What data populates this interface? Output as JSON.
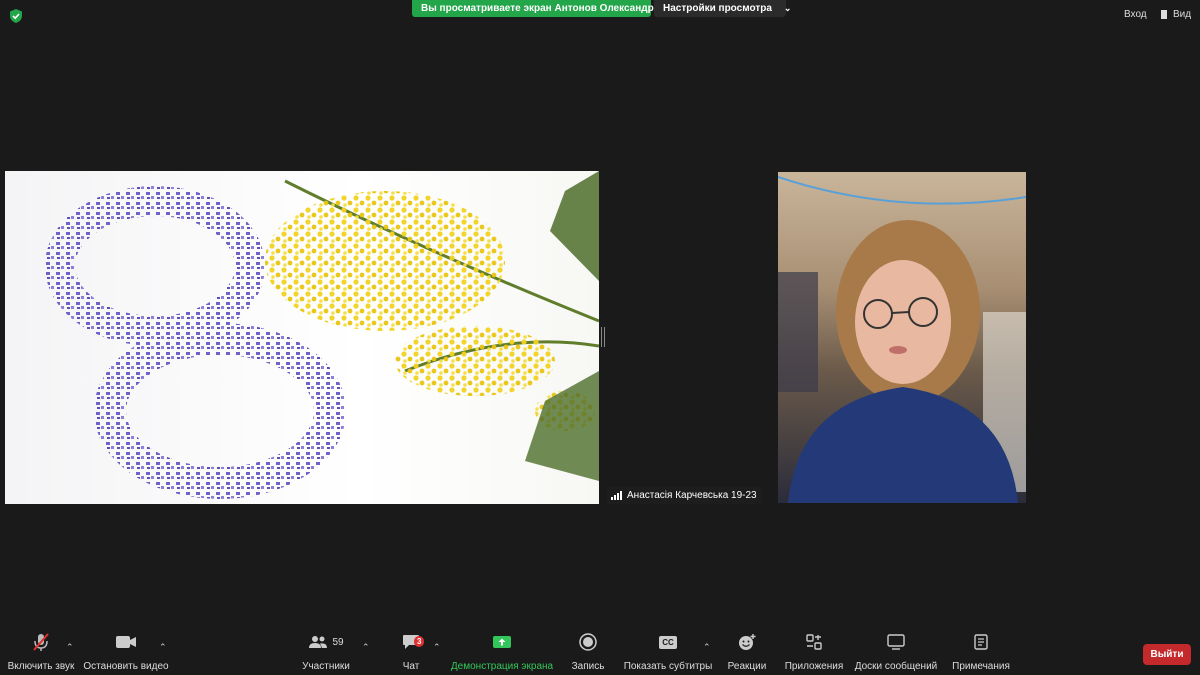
{
  "top": {
    "share_banner": "Вы просматриваете экран Антонов Олександр",
    "view_settings": "Настройки просмотра",
    "enter": "Вход",
    "view": "Вид"
  },
  "participant": {
    "name": "Анастасія Карчевська 19-23"
  },
  "toolbar": {
    "unmute": "Включить звук",
    "stop_video": "Остановить видео",
    "participants": "Участники",
    "participants_count": "59",
    "chat": "Чат",
    "chat_badge": "3",
    "share_screen": "Демонстрация экрана",
    "record": "Запись",
    "captions": "Показать субтитры",
    "captions_icon_text": "CC",
    "reactions": "Реакции",
    "apps": "Приложения",
    "whiteboards": "Доски сообщений",
    "notes": "Примечания",
    "leave": "Выйти"
  },
  "colors": {
    "background": "#1a1a1a",
    "share_banner": "#23a54a",
    "leave_button": "#c4292b",
    "share_screen_active": "#33c65a"
  }
}
